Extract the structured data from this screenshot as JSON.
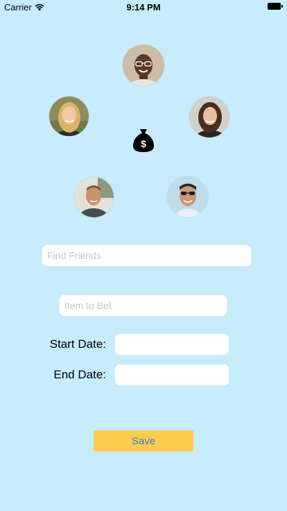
{
  "status_bar": {
    "carrier": "Carrier",
    "time": "9:14 PM",
    "wifi_icon": "wifi-icon",
    "battery_icon": "battery-icon"
  },
  "avatars": [
    {
      "id": "friend-top",
      "icon": "avatar-photo"
    },
    {
      "id": "friend-left",
      "icon": "avatar-photo"
    },
    {
      "id": "friend-right",
      "icon": "avatar-photo"
    },
    {
      "id": "friend-bottom-left",
      "icon": "avatar-photo"
    },
    {
      "id": "friend-bottom-right",
      "icon": "avatar-photo"
    }
  ],
  "center_icon": "money-bag-icon",
  "form": {
    "find_friends_placeholder": "Find Friends",
    "find_friends_value": "",
    "item_to_bet_placeholder": "Item to Bet",
    "item_to_bet_value": "",
    "start_date_label": "Start Date:",
    "start_date_value": "",
    "end_date_label": "End Date:",
    "end_date_value": "",
    "save_label": "Save"
  },
  "colors": {
    "background": "#c7ecfd",
    "save_button_bg": "#ffcd4c",
    "save_button_text": "#2e7fd8"
  }
}
